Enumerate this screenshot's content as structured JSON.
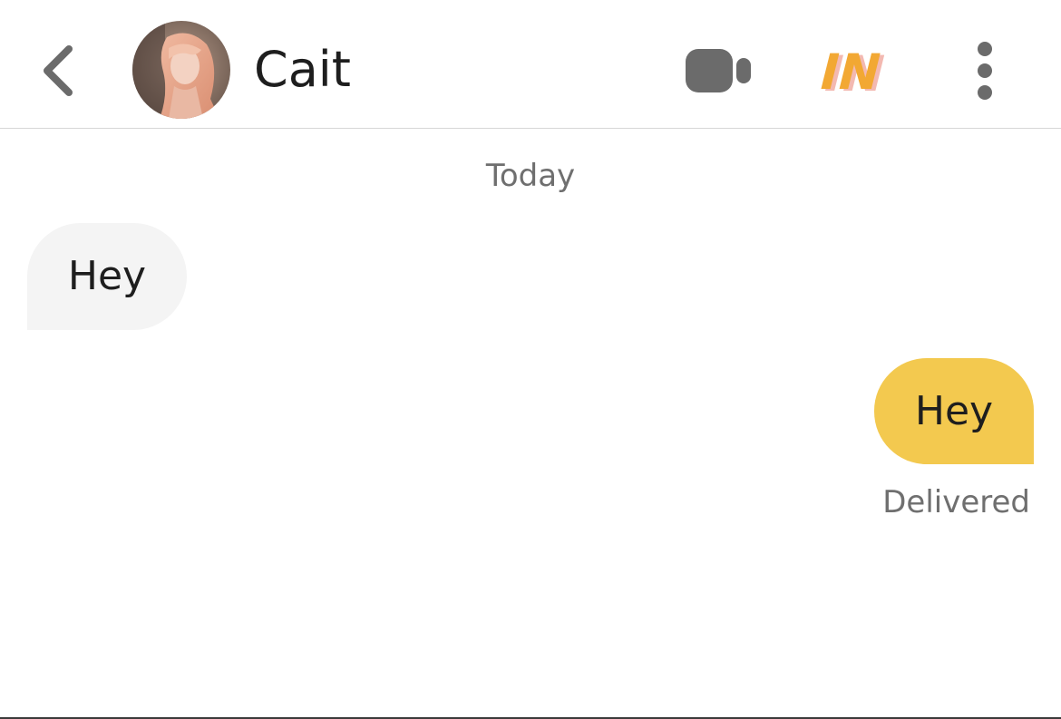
{
  "header": {
    "back_icon": "chevron-left-icon",
    "contact_name": "Cait",
    "avatar_icon": "profile-photo",
    "video_icon": "video-camera-icon",
    "badge_text": "IN",
    "badge_colors": {
      "orange": "#f2a833",
      "pink": "#f3b9b1"
    },
    "more_icon": "more-vertical-icon"
  },
  "conversation": {
    "date_separator": "Today",
    "messages": [
      {
        "direction": "incoming",
        "text": "Hey"
      },
      {
        "direction": "outgoing",
        "text": "Hey",
        "status": "Delivered"
      }
    ]
  },
  "colors": {
    "accent": "#f3c94f",
    "incoming_bubble": "#f4f4f4",
    "icon_gray": "#6b6b6b",
    "meta_text": "#6f6f6f"
  }
}
